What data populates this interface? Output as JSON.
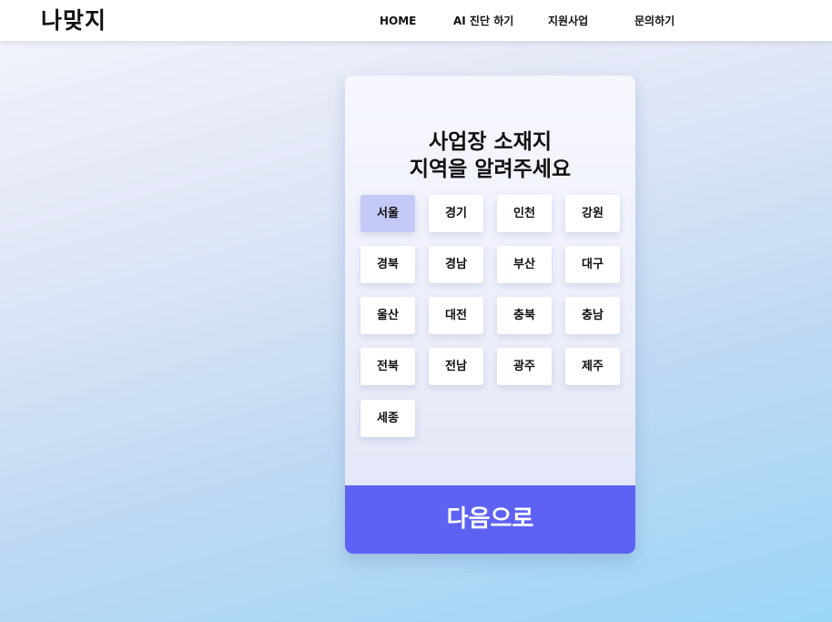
{
  "brand": {
    "logo_text": "나맞지"
  },
  "nav": {
    "items": [
      {
        "label": "HOME"
      },
      {
        "label": "AI 진단 하기"
      },
      {
        "label": "지원사업"
      },
      {
        "label": "문의하기"
      }
    ]
  },
  "card": {
    "title_line1": "사업장 소재지",
    "title_line2": "지역을 알려주세요",
    "selected_region": "서울",
    "regions": [
      "서울",
      "경기",
      "인천",
      "강원",
      "경북",
      "경남",
      "부산",
      "대구",
      "울산",
      "대전",
      "충북",
      "충남",
      "전북",
      "전남",
      "광주",
      "제주",
      "세종"
    ],
    "next_label": "다음으로"
  },
  "colors": {
    "accent": "#5e62f3",
    "selected": "#c5c9f8"
  }
}
